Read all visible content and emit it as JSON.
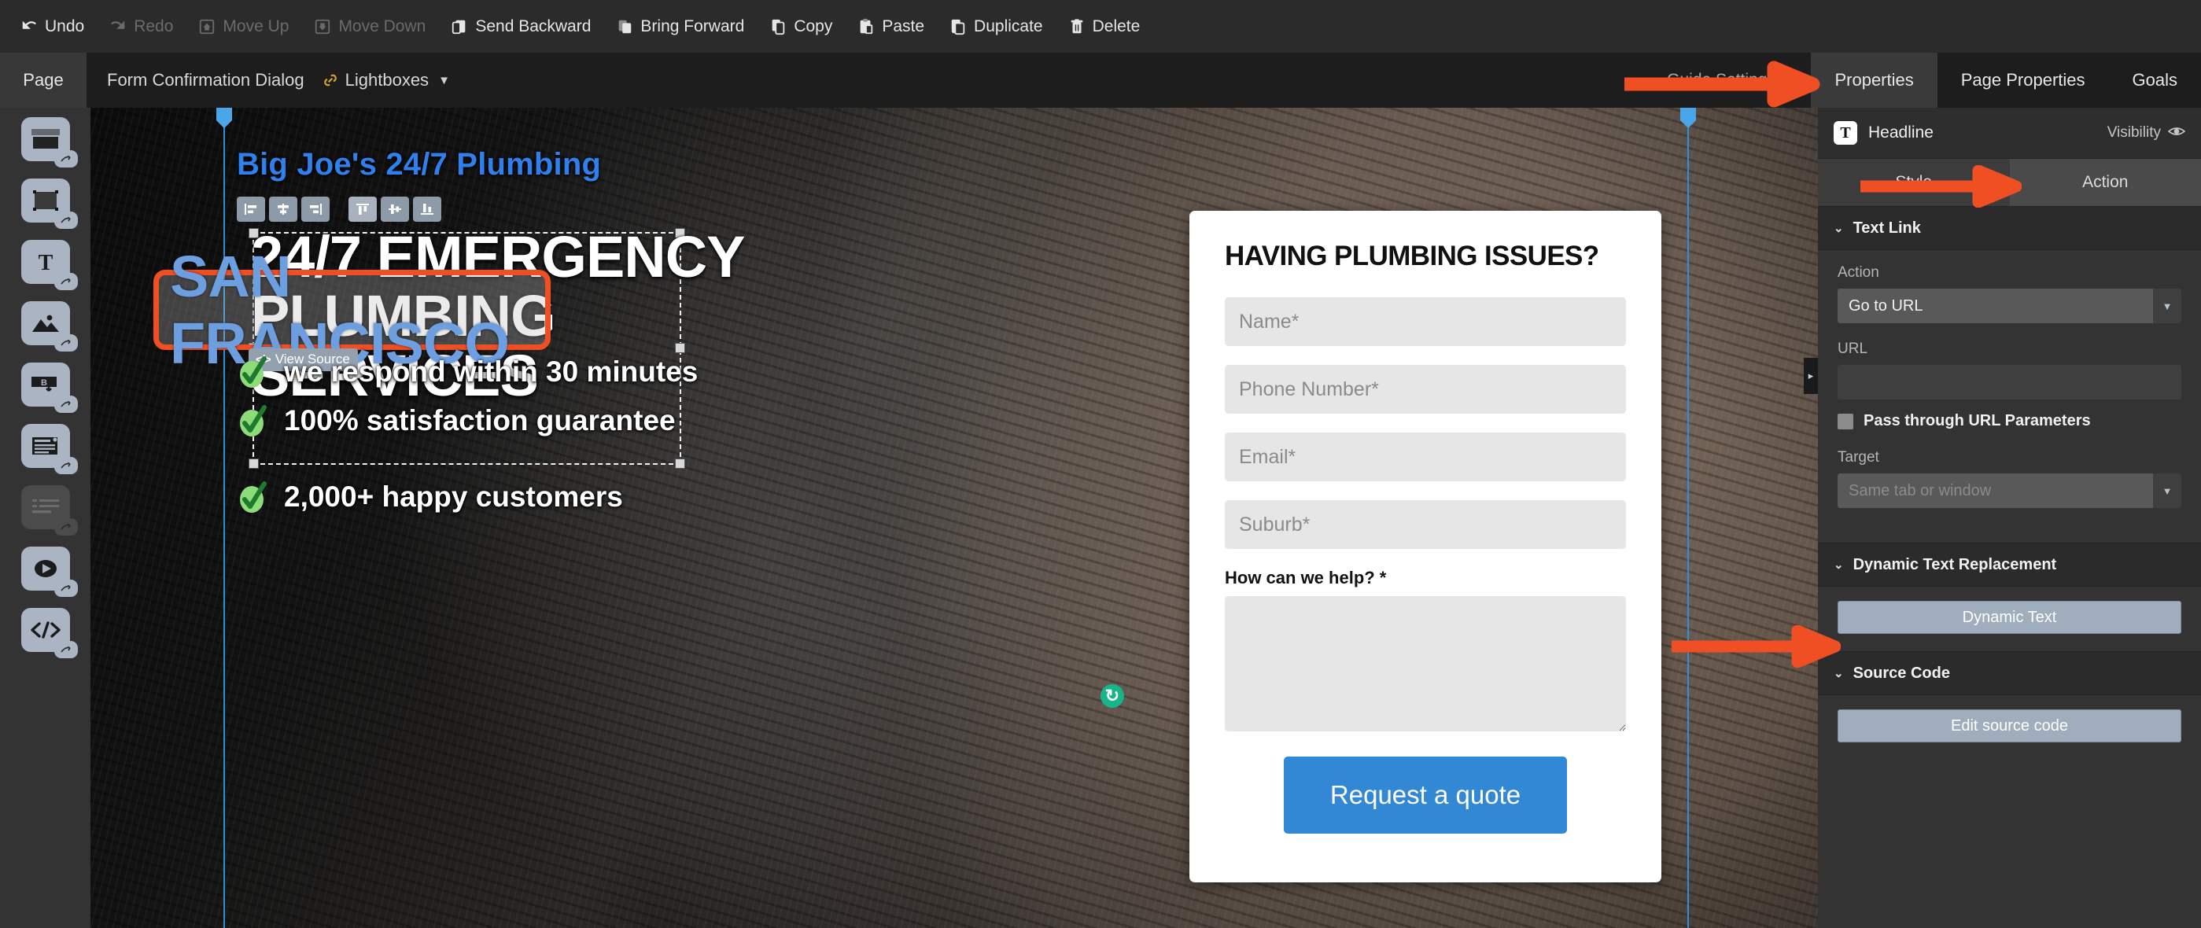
{
  "toolbar": {
    "items": [
      {
        "label": "Undo",
        "icon": "undo-icon",
        "disabled": false
      },
      {
        "label": "Redo",
        "icon": "redo-icon",
        "disabled": true
      },
      {
        "label": "Move Up",
        "icon": "move-up-icon",
        "disabled": true
      },
      {
        "label": "Move Down",
        "icon": "move-down-icon",
        "disabled": true
      },
      {
        "label": "Send Backward",
        "icon": "send-backward-icon",
        "disabled": false
      },
      {
        "label": "Bring Forward",
        "icon": "bring-forward-icon",
        "disabled": false
      },
      {
        "label": "Copy",
        "icon": "copy-icon",
        "disabled": false
      },
      {
        "label": "Paste",
        "icon": "paste-icon",
        "disabled": false
      },
      {
        "label": "Duplicate",
        "icon": "duplicate-icon",
        "disabled": false
      },
      {
        "label": "Delete",
        "icon": "delete-icon",
        "disabled": false
      }
    ]
  },
  "tabbar": {
    "page_tab": "Page",
    "document_title": "Form Confirmation Dialog",
    "lightboxes_label": "Lightboxes",
    "lightboxes_caret": "▼",
    "guide_settings": "Guide Settings",
    "guide_settings_caret": "▾",
    "right_tabs": [
      {
        "label": "Properties",
        "active": true
      },
      {
        "label": "Page Properties",
        "active": false
      },
      {
        "label": "Goals",
        "active": false
      }
    ]
  },
  "rail": {
    "tools": [
      {
        "name": "section-tool",
        "disabled": false
      },
      {
        "name": "box-tool",
        "disabled": false
      },
      {
        "name": "text-tool",
        "disabled": false
      },
      {
        "name": "image-tool",
        "disabled": false
      },
      {
        "name": "button-tool",
        "disabled": false
      },
      {
        "name": "form-tool",
        "disabled": false
      },
      {
        "name": "list-tool",
        "disabled": true
      },
      {
        "name": "video-tool",
        "disabled": false
      },
      {
        "name": "html-tool",
        "disabled": false
      }
    ]
  },
  "canvas": {
    "brand": "Big Joe's 24/7 Plumbing",
    "headline_lines": [
      "24/7 EMERGENCY",
      "PLUMBING",
      "SERVICES"
    ],
    "selected_text": "SAN FRANCISCO",
    "view_source_label": "View Source",
    "view_source_icon": "</>",
    "rotate_handle_glyph": "↻",
    "align_buttons": [
      {
        "name": "align-left",
        "active": false
      },
      {
        "name": "align-center",
        "active": false
      },
      {
        "name": "align-right",
        "active": false
      },
      {
        "name": "align-top",
        "active": true
      },
      {
        "name": "align-middle",
        "active": false
      },
      {
        "name": "align-bottom",
        "active": false
      }
    ],
    "bullets": [
      "we respond within 30 minutes",
      "100% satisfaction guarantee",
      "2,000+ happy customers"
    ]
  },
  "form_card": {
    "heading": "HAVING PLUMBING ISSUES?",
    "fields": [
      {
        "name": "name-field",
        "placeholder": "Name*",
        "value": ""
      },
      {
        "name": "phone-field",
        "placeholder": "Phone Number*",
        "value": ""
      },
      {
        "name": "email-field",
        "placeholder": "Email*",
        "value": ""
      },
      {
        "name": "suburb-field",
        "placeholder": "Suburb*",
        "value": ""
      }
    ],
    "textarea_label": "How can we help? *",
    "textarea_value": "",
    "submit_label": "Request a quote"
  },
  "panel": {
    "element_type": "Headline",
    "type_badge": "T",
    "visibility_label": "Visibility",
    "visibility_icon": "eye-icon",
    "tabs": [
      {
        "label": "Style",
        "active": false
      },
      {
        "label": "Action",
        "active": true
      }
    ],
    "sections": {
      "text_link": {
        "title": "Text Link",
        "chevron": "⌄",
        "action_label": "Action",
        "action_value": "Go to URL",
        "url_label": "URL",
        "url_value": "",
        "pass_through_label": "Pass through URL Parameters",
        "pass_through_checked": false,
        "target_label": "Target",
        "target_value": "Same tab or window",
        "target_disabled": true
      },
      "dynamic_text": {
        "title": "Dynamic Text Replacement",
        "chevron": "⌄",
        "button_label": "Dynamic Text"
      },
      "source_code": {
        "title": "Source Code",
        "chevron": "⌄",
        "button_label": "Edit source code"
      }
    },
    "collapse_glyph": "▸"
  },
  "colors": {
    "accent_orange": "#f04e23",
    "brand_blue": "#2f80ed",
    "cta_blue": "#3288d4",
    "selected_text_blue": "#6d9ee0",
    "guide_blue": "#2f8fd8",
    "rotate_green": "#18b48a"
  }
}
